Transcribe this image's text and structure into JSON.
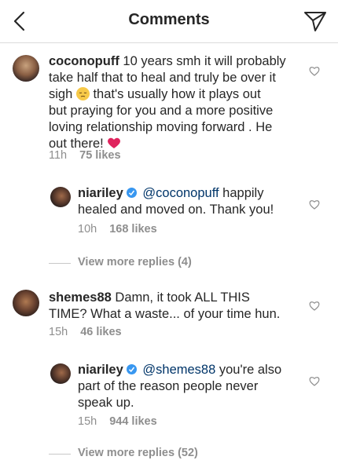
{
  "header": {
    "title": "Comments"
  },
  "comments": [
    {
      "username": "coconopuff",
      "text_line1": "10 years smh it will probably",
      "text_line2": "take half that to heal and truly be over it",
      "text_line3a": "sigh",
      "text_line3b": "that's usually how it plays out",
      "text_line4": "but praying for you and a more positive",
      "text_line5": "loving relationship moving forward . He",
      "text_line6": "out there!",
      "time": "11h",
      "likes": "75 likes"
    },
    {
      "username": "shemes88",
      "text_line1": "Damn, it took ALL THIS",
      "text_line2": "TIME? What a waste... of your time hun.",
      "time": "15h",
      "likes": "46 likes"
    }
  ],
  "replies": [
    {
      "username": "niariley",
      "mention": "@coconopuff",
      "text_line1": "happily",
      "text_line2": "healed and moved on. Thank you!",
      "time": "10h",
      "likes": "168 likes"
    },
    {
      "username": "niariley",
      "mention": "@shemes88",
      "text_line1": "you're also",
      "text_line2": "part of the reason people never",
      "text_line3": "speak up.",
      "time": "15h",
      "likes": "944 likes"
    }
  ],
  "view_more": [
    "View more replies (4)",
    "View more replies (52)"
  ],
  "icons": {
    "back": "chevron-left-icon",
    "send": "paper-plane-icon",
    "like": "heart-outline-icon",
    "verified": "verified-badge-icon",
    "pensive": "pensive-face-emoji",
    "red_heart": "red-heart-emoji"
  },
  "colors": {
    "mention": "#003569",
    "verified": "#3897f0",
    "meta": "#8e8e8e",
    "heart_emoji": "#e0245e"
  }
}
